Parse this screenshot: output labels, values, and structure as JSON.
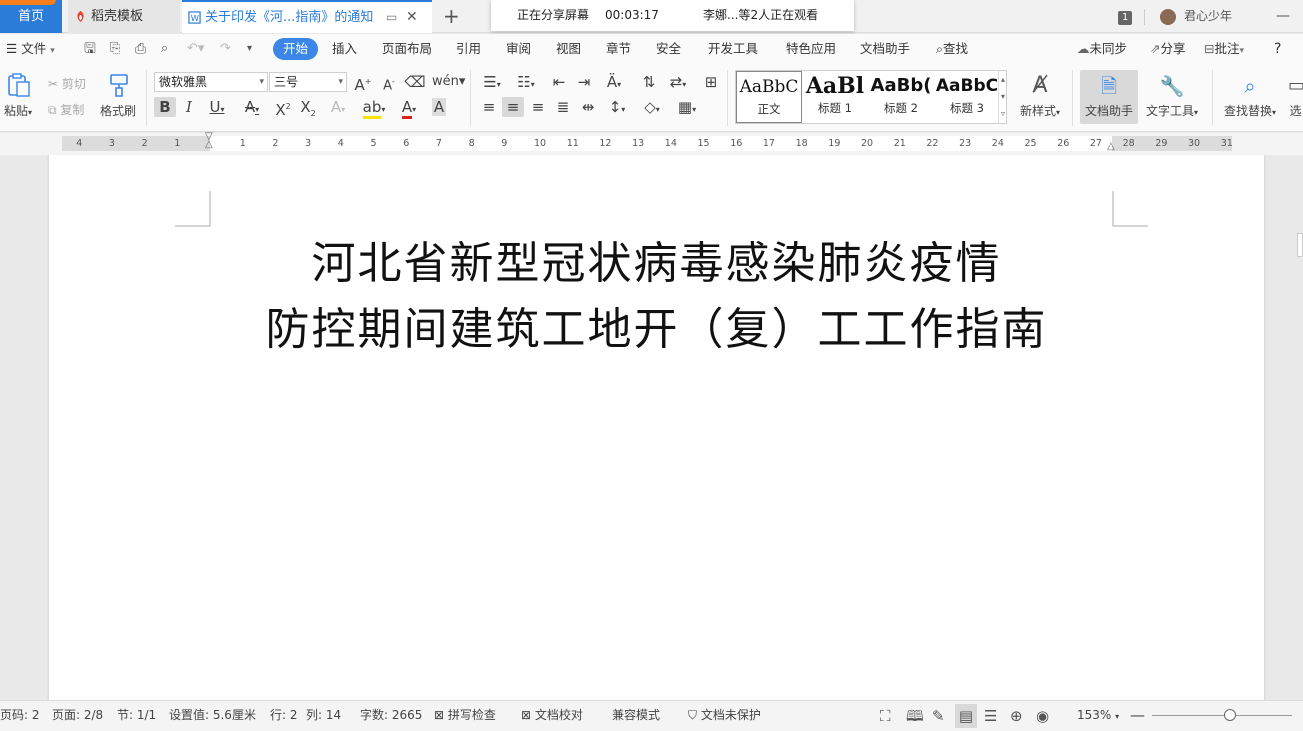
{
  "titlebar": {
    "home_tab": "首页",
    "templates_tab": "稻壳模板",
    "doc_tab": "关于印发《河...指南》的通知",
    "share_status": "正在分享屏幕",
    "share_timer": "00:03:17",
    "viewers": "李娜...等2人正在观看",
    "user_name": "君心少年",
    "badge": "1"
  },
  "menu": {
    "file": "文件",
    "tabs": [
      "开始",
      "插入",
      "页面布局",
      "引用",
      "审阅",
      "视图",
      "章节",
      "安全",
      "开发工具",
      "特色应用",
      "文档助手"
    ],
    "search": "查找",
    "unsync": "未同步",
    "share": "分享",
    "comment": "批注",
    "help": "?"
  },
  "ribbon": {
    "paste": "粘贴",
    "cut": "剪切",
    "copy": "复制",
    "format_painter": "格式刷",
    "font_name": "微软雅黑",
    "font_size": "三号",
    "styles": [
      {
        "sample": "AaBbC",
        "name": "正文"
      },
      {
        "sample": "AaBl",
        "name": "标题 1"
      },
      {
        "sample": "AaBb(",
        "name": "标题 2"
      },
      {
        "sample": "AaBbC",
        "name": "标题 3"
      }
    ],
    "new_style": "新样式",
    "doc_assistant": "文档助手",
    "text_tools": "文字工具",
    "find_replace": "查找替换",
    "select": "选"
  },
  "ruler": {
    "labels": [
      "4",
      "3",
      "2",
      "1",
      "1",
      "2",
      "3",
      "4",
      "5",
      "6",
      "7",
      "8",
      "9",
      "10",
      "11",
      "12",
      "13",
      "14",
      "15",
      "16",
      "17",
      "18",
      "19",
      "20",
      "21",
      "22",
      "23",
      "24",
      "25",
      "26",
      "27",
      "28",
      "29",
      "30",
      "31"
    ]
  },
  "document": {
    "title_line1": "河北省新型冠状病毒感染肺炎疫情",
    "title_line2": "防控期间建筑工地开（复）工工作指南"
  },
  "status": {
    "page_code": "页码: 2",
    "page": "页面: 2/8",
    "section": "节: 1/1",
    "setting": "设置值: 5.6厘米",
    "row": "行: 2",
    "col": "列: 14",
    "word_count": "字数: 2665",
    "spell_check": "拼写检查",
    "doc_proof": "文档校对",
    "compat_mode": "兼容模式",
    "protect": "文档未保护",
    "zoom": "153%"
  },
  "colors": {
    "accent": "#2b7bd9",
    "menu_active": "#3b86e6",
    "orange": "#f77e1c"
  }
}
